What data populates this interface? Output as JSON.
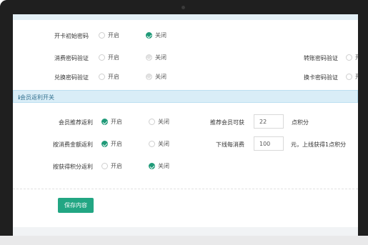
{
  "rows_top": [
    {
      "label": "开卡初始密码",
      "on": "开启",
      "off": "关闭",
      "selected": "off",
      "disabled": false
    },
    {
      "label": "消费密码验证",
      "on": "开启",
      "off": "关闭",
      "selected": "off",
      "disabled": true,
      "right_label": "转账密码验证",
      "right_option": "开"
    },
    {
      "label": "兑换密码验证",
      "on": "开启",
      "off": "关闭",
      "selected": "off",
      "disabled": true,
      "right_label": "换卡密码验证",
      "right_option": "开"
    }
  ],
  "section": {
    "icon": "info-icon",
    "title": "会员返利开关"
  },
  "rows_rebate": [
    {
      "label": "会员推荐返利",
      "on": "开启",
      "off": "关闭",
      "selected": "on",
      "right_label": "推荐会员可获",
      "value": "22",
      "unit": "点积分"
    },
    {
      "label": "按消费金额返利",
      "on": "开启",
      "off": "关闭",
      "selected": "on",
      "right_label": "下线每消费",
      "value": "100",
      "unit": "元，上线获得1点积分"
    },
    {
      "label": "按获得积分返利",
      "on": "开启",
      "off": "关闭",
      "selected": "off"
    }
  ],
  "save_label": "保存内容",
  "colors": {
    "accent": "#22a683",
    "info_bg": "#d9edf7",
    "info_text": "#31708f"
  }
}
